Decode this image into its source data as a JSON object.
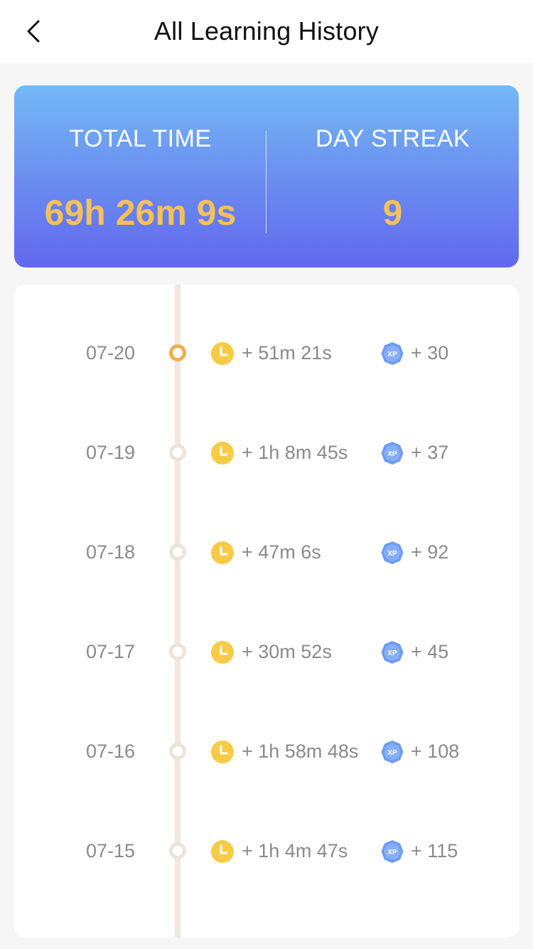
{
  "header": {
    "title": "All Learning History",
    "back_icon": "chevron-left-icon"
  },
  "summary": {
    "total_time_label": "TOTAL TIME",
    "total_time_value": "69h 26m 9s",
    "day_streak_label": "DAY STREAK",
    "day_streak_value": "9"
  },
  "colors": {
    "accent_gold": "#f6c15a",
    "card_gradient_top": "#74b9f5",
    "card_gradient_bottom": "#6268ee",
    "timeline_active": "#efae4b",
    "clock_yellow": "#f7cb47",
    "xp_blue": "#6d9bf2"
  },
  "history": [
    {
      "date": "07-20",
      "time": "+ 51m 21s",
      "xp": "+ 30",
      "active": true
    },
    {
      "date": "07-19",
      "time": "+ 1h 8m 45s",
      "xp": "+ 37",
      "active": false
    },
    {
      "date": "07-18",
      "time": "+ 47m 6s",
      "xp": "+ 92",
      "active": false
    },
    {
      "date": "07-17",
      "time": "+ 30m 52s",
      "xp": "+ 45",
      "active": false
    },
    {
      "date": "07-16",
      "time": "+ 1h 58m 48s",
      "xp": "+ 108",
      "active": false
    },
    {
      "date": "07-15",
      "time": "+ 1h 4m 47s",
      "xp": "+ 115",
      "active": false
    }
  ],
  "xp_badge_text": "XP"
}
